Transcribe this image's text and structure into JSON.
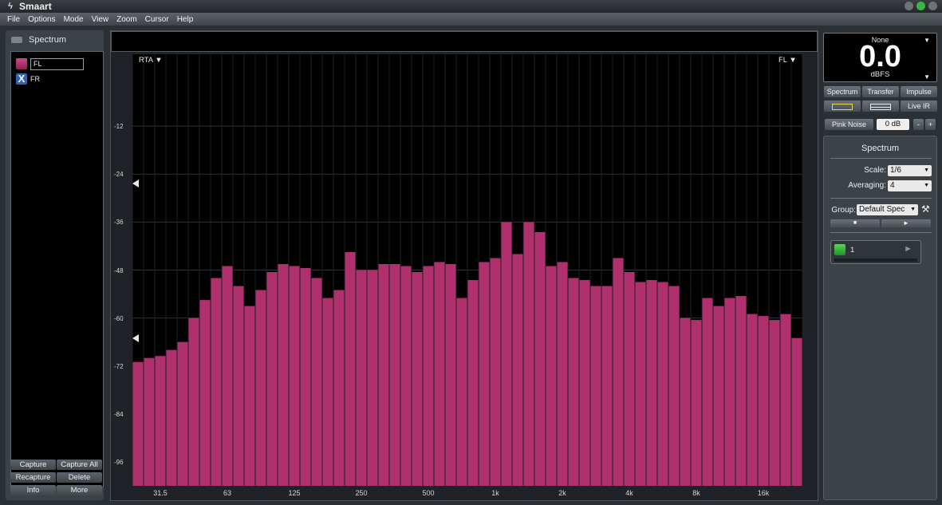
{
  "window": {
    "title": "Smaart",
    "close_colors": [
      "#6d7277",
      "#3bb54a",
      "#6d7277"
    ]
  },
  "menu": [
    "File",
    "Options",
    "Mode",
    "View",
    "Zoom",
    "Cursor",
    "Help"
  ],
  "left_panel": {
    "title": "Spectrum",
    "traces": [
      {
        "name": "FL",
        "color": "#b0306e"
      },
      {
        "name": "FR",
        "color": "#1f5fb0",
        "icon": "X"
      }
    ],
    "buttons": [
      "Capture",
      "Capture All",
      "Recapture",
      "Delete",
      "Info",
      "More"
    ]
  },
  "graph": {
    "left_label": "RTA ▼",
    "right_label": "FL ▼",
    "bar_color": "#b0306e"
  },
  "chart_data": {
    "type": "bar",
    "ylim": [
      -102,
      6
    ],
    "yticks": [
      -12,
      -24,
      -36,
      -48,
      -60,
      -72,
      -84,
      -96
    ],
    "xtick_labels": [
      "31.5",
      "63",
      "125",
      "250",
      "500",
      "1k",
      "2k",
      "4k",
      "8k",
      "16k"
    ],
    "series": [
      {
        "values": [
          -71,
          -70,
          -69.5,
          -68,
          -66,
          -60,
          -55.5,
          -50,
          -47,
          -52,
          -57,
          -53,
          -48.5,
          -46.5,
          -47,
          -47.5,
          -50,
          -55,
          -53,
          -43.5,
          -48,
          -48,
          -46.5,
          -46.5,
          -47,
          -48.5,
          -47,
          -46,
          -46.5,
          -55,
          -50.5,
          -46,
          -45,
          -36,
          -44,
          -36,
          -38.5,
          -47,
          -46,
          -50,
          -50.5,
          -52,
          -52,
          -45,
          -48.5,
          -51,
          -50.5,
          -51,
          -52,
          -60,
          -60.5,
          -55,
          -57,
          -55,
          -54.5,
          -59,
          -59.5,
          -60.5,
          -59,
          -65
        ]
      }
    ]
  },
  "right_panel": {
    "meter": {
      "source": "None",
      "value": "0.0",
      "unit": "dBFS"
    },
    "mode_buttons": [
      "Spectrum",
      "Transfer",
      "Impulse"
    ],
    "live_ir": "Live IR",
    "pink_noise": {
      "label": "Pink Noise",
      "level": "0 dB",
      "minus": "-",
      "plus": "+"
    },
    "spectrum": {
      "title": "Spectrum",
      "scale_label": "Scale:",
      "scale_value": "1/6",
      "averaging_label": "Averaging:",
      "averaging_value": "4",
      "group_label": "Group:",
      "group_value": "Default Spec",
      "meter_name": "1"
    }
  }
}
